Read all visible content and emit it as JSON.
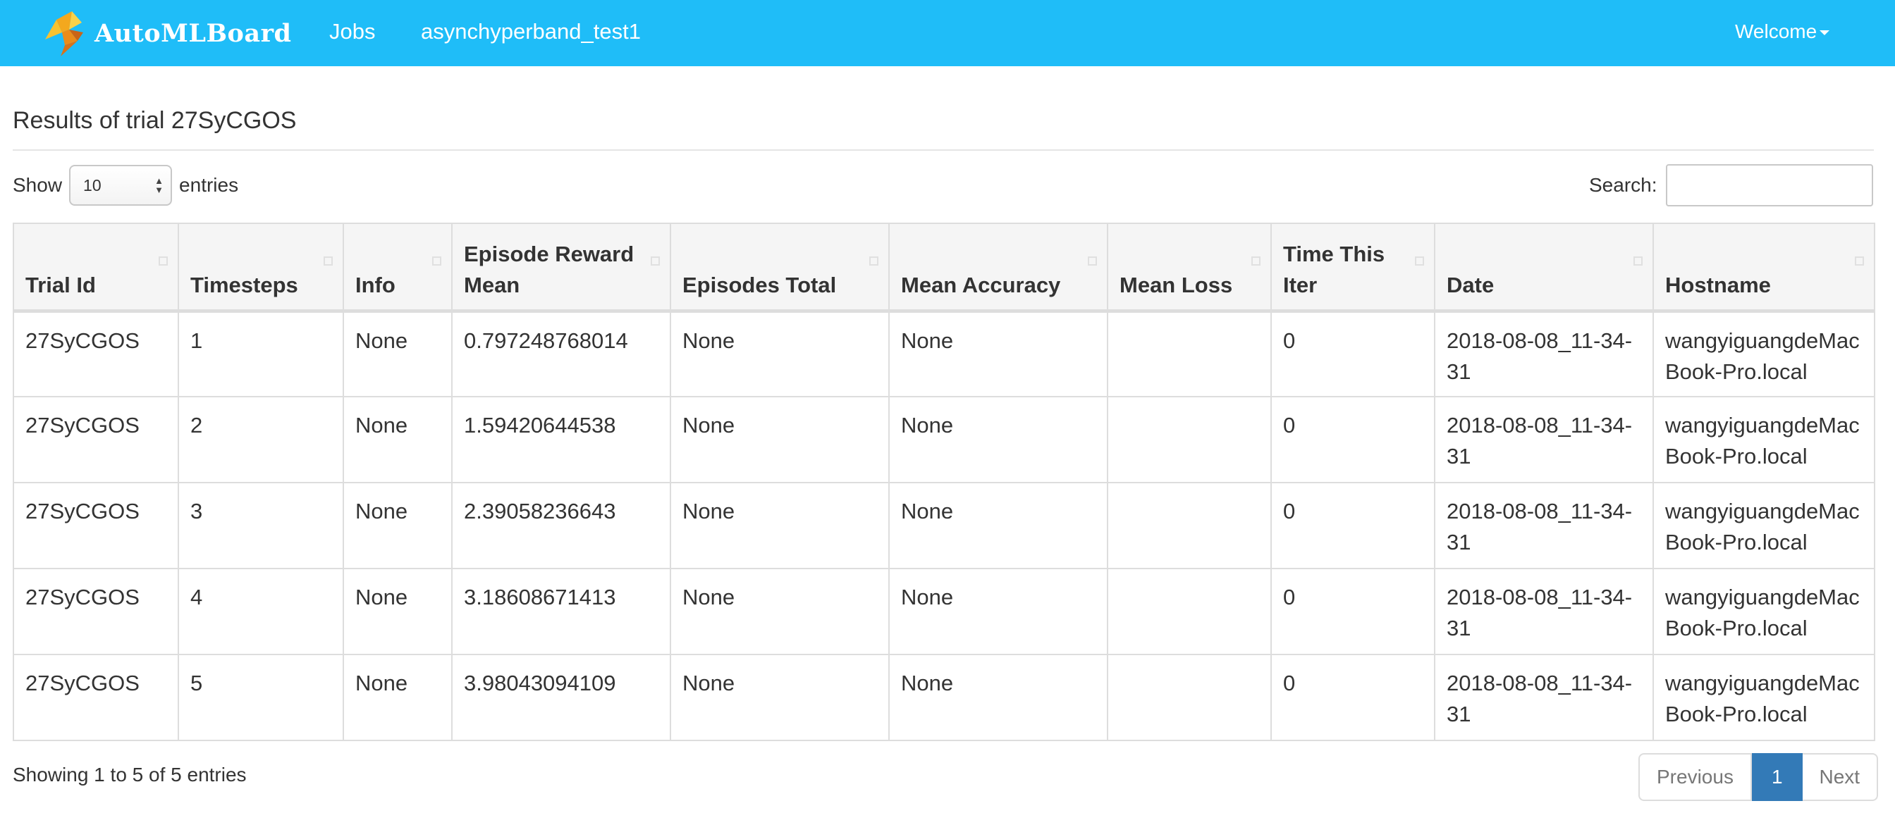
{
  "navbar": {
    "brand": "AutoMLBoard",
    "jobs_link": "Jobs",
    "job_name": "asynchyperband_test1",
    "welcome": "Welcome"
  },
  "page": {
    "title": "Results of trial 27SyCGOS"
  },
  "length_control": {
    "show_label": "Show",
    "selected": "10",
    "entries_label": "entries"
  },
  "search": {
    "label": "Search:",
    "value": "",
    "placeholder": ""
  },
  "table": {
    "columns": [
      "Trial Id",
      "Timesteps",
      "Info",
      "Episode Reward Mean",
      "Episodes Total",
      "Mean Accuracy",
      "Mean Loss",
      "Time This Iter",
      "Date",
      "Hostname"
    ],
    "rows": [
      [
        "27SyCGOS",
        "1",
        "None",
        "0.797248768014",
        "None",
        "None",
        "",
        "0",
        "2018-08-08_11-34-31",
        "wangyiguangdeMacBook-Pro.local"
      ],
      [
        "27SyCGOS",
        "2",
        "None",
        "1.59420644538",
        "None",
        "None",
        "",
        "0",
        "2018-08-08_11-34-31",
        "wangyiguangdeMacBook-Pro.local"
      ],
      [
        "27SyCGOS",
        "3",
        "None",
        "2.39058236643",
        "None",
        "None",
        "",
        "0",
        "2018-08-08_11-34-31",
        "wangyiguangdeMacBook-Pro.local"
      ],
      [
        "27SyCGOS",
        "4",
        "None",
        "3.18608671413",
        "None",
        "None",
        "",
        "0",
        "2018-08-08_11-34-31",
        "wangyiguangdeMacBook-Pro.local"
      ],
      [
        "27SyCGOS",
        "5",
        "None",
        "3.98043094109",
        "None",
        "None",
        "",
        "0",
        "2018-08-08_11-34-31",
        "wangyiguangdeMacBook-Pro.local"
      ]
    ]
  },
  "footer": {
    "info": "Showing 1 to 5 of 5 entries",
    "previous": "Previous",
    "current_page": "1",
    "next": "Next"
  },
  "colors": {
    "navbar": "#1fbdf8",
    "active_page": "#337ab7"
  },
  "icons": {
    "brand_logo": "bird-logo-icon",
    "sort": "sort-icon",
    "dropdown": "caret-down-icon"
  }
}
